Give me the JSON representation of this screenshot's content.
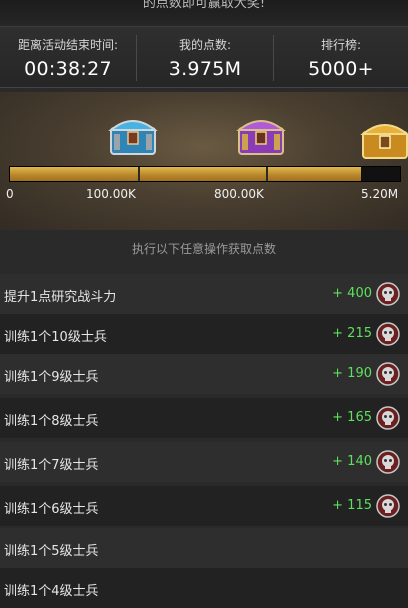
{
  "top_banner": {
    "text": "的点数即可赢取大奖!"
  },
  "stats": [
    {
      "label": "距离活动结束时间:",
      "value": "00:38:27"
    },
    {
      "label": "我的点数:",
      "value": "3.975M"
    },
    {
      "label": "排行榜:",
      "value": "5000+"
    }
  ],
  "progress": {
    "fill_fraction": 0.9,
    "labels": [
      "0",
      "100.00K",
      "800.00K",
      "5.20M"
    ]
  },
  "chests": [
    {
      "name": "blue-chest",
      "color": "#3aa6d6"
    },
    {
      "name": "purple-chest",
      "color": "#a44cd0"
    },
    {
      "name": "gold-chest",
      "color": "#e0a630"
    }
  ],
  "section_title": "执行以下任意操作获取点数",
  "tasks": [
    {
      "name": "提升1点研究战斗力",
      "points": "+ 400"
    },
    {
      "name": "训练1个10级士兵",
      "points": "+ 215"
    },
    {
      "name": "训练1个9级士兵",
      "points": "+ 190"
    },
    {
      "name": "训练1个8级士兵",
      "points": "+ 165"
    },
    {
      "name": "训练1个7级士兵",
      "points": "+ 140"
    },
    {
      "name": "训练1个6级士兵",
      "points": "+ 115"
    },
    {
      "name": "训练1个5级士兵",
      "points": ""
    },
    {
      "name": "训练1个4级士兵",
      "points": ""
    }
  ]
}
